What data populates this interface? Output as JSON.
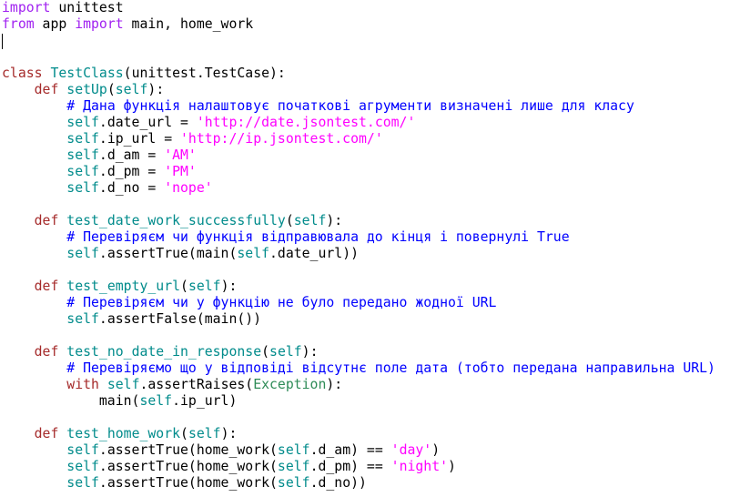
{
  "window": {
    "type": "code-editor",
    "language": "python"
  },
  "colors": {
    "keyword": "#a52a2a",
    "import_keyword": "#a020f0",
    "function_name": "#008b8b",
    "self": "#008b8b",
    "string": "#ff00ff",
    "comment": "#0000ff",
    "builtin": "#2e8b57",
    "default": "#000000"
  },
  "editor": {
    "caret_line": 3,
    "lines": [
      [
        {
          "t": "import",
          "c": "import_keyword"
        },
        {
          "t": " unittest",
          "c": "default"
        }
      ],
      [
        {
          "t": "from",
          "c": "import_keyword"
        },
        {
          "t": " app ",
          "c": "default"
        },
        {
          "t": "import",
          "c": "import_keyword"
        },
        {
          "t": " main, home_work",
          "c": "default"
        }
      ],
      [],
      [],
      [
        {
          "t": "class",
          "c": "keyword"
        },
        {
          "t": " ",
          "c": "default"
        },
        {
          "t": "TestClass",
          "c": "function_name"
        },
        {
          "t": "(unittest.TestCase):",
          "c": "default"
        }
      ],
      [
        {
          "t": "    ",
          "c": "default"
        },
        {
          "t": "def",
          "c": "keyword"
        },
        {
          "t": " ",
          "c": "default"
        },
        {
          "t": "setUp",
          "c": "function_name"
        },
        {
          "t": "(",
          "c": "default"
        },
        {
          "t": "self",
          "c": "self"
        },
        {
          "t": "):",
          "c": "default"
        }
      ],
      [
        {
          "t": "        ",
          "c": "default"
        },
        {
          "t": "# Дана функція налаштовує початкові агрументи визначені лише для класу",
          "c": "comment"
        }
      ],
      [
        {
          "t": "        ",
          "c": "default"
        },
        {
          "t": "self",
          "c": "self"
        },
        {
          "t": ".date_url = ",
          "c": "default"
        },
        {
          "t": "'http://date.jsontest.com/'",
          "c": "string"
        }
      ],
      [
        {
          "t": "        ",
          "c": "default"
        },
        {
          "t": "self",
          "c": "self"
        },
        {
          "t": ".ip_url = ",
          "c": "default"
        },
        {
          "t": "'http://ip.jsontest.com/'",
          "c": "string"
        }
      ],
      [
        {
          "t": "        ",
          "c": "default"
        },
        {
          "t": "self",
          "c": "self"
        },
        {
          "t": ".d_am = ",
          "c": "default"
        },
        {
          "t": "'AM'",
          "c": "string"
        }
      ],
      [
        {
          "t": "        ",
          "c": "default"
        },
        {
          "t": "self",
          "c": "self"
        },
        {
          "t": ".d_pm = ",
          "c": "default"
        },
        {
          "t": "'PM'",
          "c": "string"
        }
      ],
      [
        {
          "t": "        ",
          "c": "default"
        },
        {
          "t": "self",
          "c": "self"
        },
        {
          "t": ".d_no = ",
          "c": "default"
        },
        {
          "t": "'nope'",
          "c": "string"
        }
      ],
      [],
      [
        {
          "t": "    ",
          "c": "default"
        },
        {
          "t": "def",
          "c": "keyword"
        },
        {
          "t": " ",
          "c": "default"
        },
        {
          "t": "test_date_work_successfully",
          "c": "function_name"
        },
        {
          "t": "(",
          "c": "default"
        },
        {
          "t": "self",
          "c": "self"
        },
        {
          "t": "):",
          "c": "default"
        }
      ],
      [
        {
          "t": "        ",
          "c": "default"
        },
        {
          "t": "# Перевіряєм чи функція відправювала до кінця і повернулі True",
          "c": "comment"
        }
      ],
      [
        {
          "t": "        ",
          "c": "default"
        },
        {
          "t": "self",
          "c": "self"
        },
        {
          "t": ".assertTrue(main(",
          "c": "default"
        },
        {
          "t": "self",
          "c": "self"
        },
        {
          "t": ".date_url))",
          "c": "default"
        }
      ],
      [],
      [
        {
          "t": "    ",
          "c": "default"
        },
        {
          "t": "def",
          "c": "keyword"
        },
        {
          "t": " ",
          "c": "default"
        },
        {
          "t": "test_empty_url",
          "c": "function_name"
        },
        {
          "t": "(",
          "c": "default"
        },
        {
          "t": "self",
          "c": "self"
        },
        {
          "t": "):",
          "c": "default"
        }
      ],
      [
        {
          "t": "        ",
          "c": "default"
        },
        {
          "t": "# Перевіряєм чи у функцію не було передано жодної URL",
          "c": "comment"
        }
      ],
      [
        {
          "t": "        ",
          "c": "default"
        },
        {
          "t": "self",
          "c": "self"
        },
        {
          "t": ".assertFalse(main())",
          "c": "default"
        }
      ],
      [],
      [
        {
          "t": "    ",
          "c": "default"
        },
        {
          "t": "def",
          "c": "keyword"
        },
        {
          "t": " ",
          "c": "default"
        },
        {
          "t": "test_no_date_in_response",
          "c": "function_name"
        },
        {
          "t": "(",
          "c": "default"
        },
        {
          "t": "self",
          "c": "self"
        },
        {
          "t": "):",
          "c": "default"
        }
      ],
      [
        {
          "t": "        ",
          "c": "default"
        },
        {
          "t": "# Перевіряємо що у відповіді відсутнє поле дата (тобто передана направильна URL)",
          "c": "comment"
        }
      ],
      [
        {
          "t": "        ",
          "c": "default"
        },
        {
          "t": "with",
          "c": "keyword"
        },
        {
          "t": " ",
          "c": "default"
        },
        {
          "t": "self",
          "c": "self"
        },
        {
          "t": ".assertRaises(",
          "c": "default"
        },
        {
          "t": "Exception",
          "c": "builtin"
        },
        {
          "t": "):",
          "c": "default"
        }
      ],
      [
        {
          "t": "            main(",
          "c": "default"
        },
        {
          "t": "self",
          "c": "self"
        },
        {
          "t": ".ip_url)",
          "c": "default"
        }
      ],
      [],
      [
        {
          "t": "    ",
          "c": "default"
        },
        {
          "t": "def",
          "c": "keyword"
        },
        {
          "t": " ",
          "c": "default"
        },
        {
          "t": "test_home_work",
          "c": "function_name"
        },
        {
          "t": "(",
          "c": "default"
        },
        {
          "t": "self",
          "c": "self"
        },
        {
          "t": "):",
          "c": "default"
        }
      ],
      [
        {
          "t": "        ",
          "c": "default"
        },
        {
          "t": "self",
          "c": "self"
        },
        {
          "t": ".assertTrue(home_work(",
          "c": "default"
        },
        {
          "t": "self",
          "c": "self"
        },
        {
          "t": ".d_am) == ",
          "c": "default"
        },
        {
          "t": "'day'",
          "c": "string"
        },
        {
          "t": ")",
          "c": "default"
        }
      ],
      [
        {
          "t": "        ",
          "c": "default"
        },
        {
          "t": "self",
          "c": "self"
        },
        {
          "t": ".assertTrue(home_work(",
          "c": "default"
        },
        {
          "t": "self",
          "c": "self"
        },
        {
          "t": ".d_pm) == ",
          "c": "default"
        },
        {
          "t": "'night'",
          "c": "string"
        },
        {
          "t": ")",
          "c": "default"
        }
      ],
      [
        {
          "t": "        ",
          "c": "default"
        },
        {
          "t": "self",
          "c": "self"
        },
        {
          "t": ".assertTrue(home_work(",
          "c": "default"
        },
        {
          "t": "self",
          "c": "self"
        },
        {
          "t": ".d_no))",
          "c": "default"
        }
      ]
    ]
  }
}
